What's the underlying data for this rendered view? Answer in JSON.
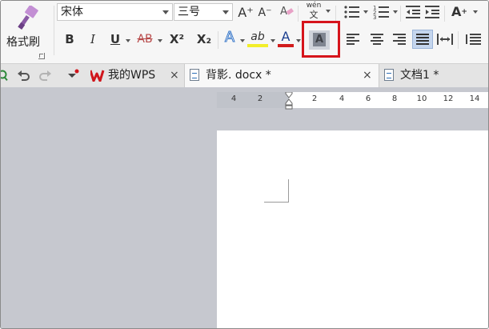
{
  "ribbon": {
    "format_painter_label": "格式刷",
    "font_name": "宋体",
    "font_size": "三号",
    "grow_font": "A⁺",
    "shrink_font": "A⁻",
    "pinyin": "wén",
    "pinyin_char": "文",
    "bold": "B",
    "italic": "I",
    "underline": "U",
    "strike": "AB",
    "superscript": "X²",
    "subscript": "X₂",
    "text_effect": "A",
    "highlight": "ab",
    "font_color": "A",
    "char_shading": "A",
    "change_case": "A"
  },
  "tabs": {
    "quick_wps": "我的WPS",
    "doc_active": "背影. docx *",
    "doc_other": "文档1 *",
    "close": "×"
  },
  "ruler": {
    "labels": [
      "4",
      "2",
      "2",
      "4",
      "6",
      "8",
      "10",
      "12",
      "14"
    ]
  },
  "colors": {
    "highlight_box": "#d6141b",
    "wps_red": "#d0161c",
    "workspace": "#c6c8cf"
  }
}
